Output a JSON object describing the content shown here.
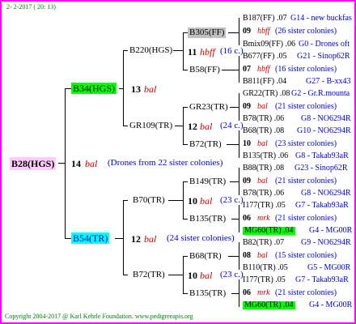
{
  "header": {
    "date": "2- 2-2017 ( 20: 13)"
  },
  "footer": {
    "copyright": "Copyright 2004-2017 @ Karl Kehrle Foundation.   www.pedigreeapis.org"
  },
  "root": {
    "id": "B28(HGS)",
    "num": "14",
    "breed": "bal",
    "note": "(Drones from 22 sister colonies)"
  },
  "gen1": {
    "top": {
      "id": "B34(HGS)",
      "num": "13",
      "breed": "bal"
    },
    "bottom": {
      "id": "B54(TR)",
      "num": "12",
      "breed": "bal",
      "note": "(24 sister colonies)"
    }
  },
  "gen2": {
    "a": {
      "id": "B220(HGS)",
      "num": "11",
      "breed": "hbff",
      "note": "(16 c.)"
    },
    "b": {
      "id": "GR109(TR)",
      "num": "12",
      "breed": "bal",
      "note": "(24 c.)"
    },
    "c": {
      "id": "B70(TR)",
      "num": "10",
      "breed": "bal",
      "note": "(23 c.)"
    },
    "d": {
      "id": "B72(TR)",
      "num": "10",
      "breed": "bal",
      "note": "(23 c.)"
    }
  },
  "gen3": {
    "a1": "B305(FF)",
    "a2": "B58(FF)",
    "b1": "GR23(TR)",
    "b2": "B72(TR)",
    "c1": "B149(TR)",
    "c2": "B135(TR)",
    "d1": "B68(TR)",
    "d2": "B135(TR)"
  },
  "gen4": [
    {
      "left": "B187(FF) .07",
      "right": "G14 - new buckfas"
    },
    {
      "num": "09",
      "breed": "hbff",
      "note": "(26 sister colonies)"
    },
    {
      "left": "Bmix09(FF) .06",
      "right": "G0 - Drones oft"
    },
    {
      "left": "B677(FF) .05",
      "right": "G21 - Sinop62R"
    },
    {
      "num": "07",
      "breed": "hbff",
      "note": "(16 sister colonies)"
    },
    {
      "left": "B811(FF) .04",
      "right": "G27 - B-xx43"
    },
    {
      "left": "GR22(TR) .08",
      "right": "G2 - Gr.R.mounta"
    },
    {
      "num": "09",
      "breed": "bal",
      "note": "(21 sister colonies)"
    },
    {
      "left": "B78(TR) .06",
      "right": "G8 - NO6294R"
    },
    {
      "left": "B68(TR) .08",
      "right": "G10 - NO6294R"
    },
    {
      "num": "10",
      "breed": "bal",
      "note": "(23 sister colonies)"
    },
    {
      "left": "B135(TR) .06",
      "right": "G8 - Takab93aR"
    },
    {
      "left": "B88(TR) .08",
      "right": "G23 - Sinop62R"
    },
    {
      "num": "09",
      "breed": "bal",
      "note": "(21 sister colonies)"
    },
    {
      "left": "B78(TR) .06",
      "right": "G8 - NO6294R"
    },
    {
      "left": "I177(TR) .05",
      "right": "G7 - Takab93aR"
    },
    {
      "num": "06",
      "breed": "mrk",
      "note": "(21 sister colonies)"
    },
    {
      "left": "MG60(TR) .04",
      "right": "G4 - MG00R"
    },
    {
      "left": "B82(TR) .07",
      "right": "G9 - NO6294R"
    },
    {
      "num": "08",
      "breed": "bal",
      "note": "(15 sister colonies)"
    },
    {
      "left": "B110(TR) .05",
      "right": "G5 - MG00R"
    },
    {
      "left": "I177(TR) .05",
      "right": "G7 - Takab93aR"
    },
    {
      "num": "06",
      "breed": "mrk",
      "note": "(21 sister colonies)"
    },
    {
      "left": "MG60(TR) .04",
      "right": "G4 - MG00R"
    }
  ]
}
